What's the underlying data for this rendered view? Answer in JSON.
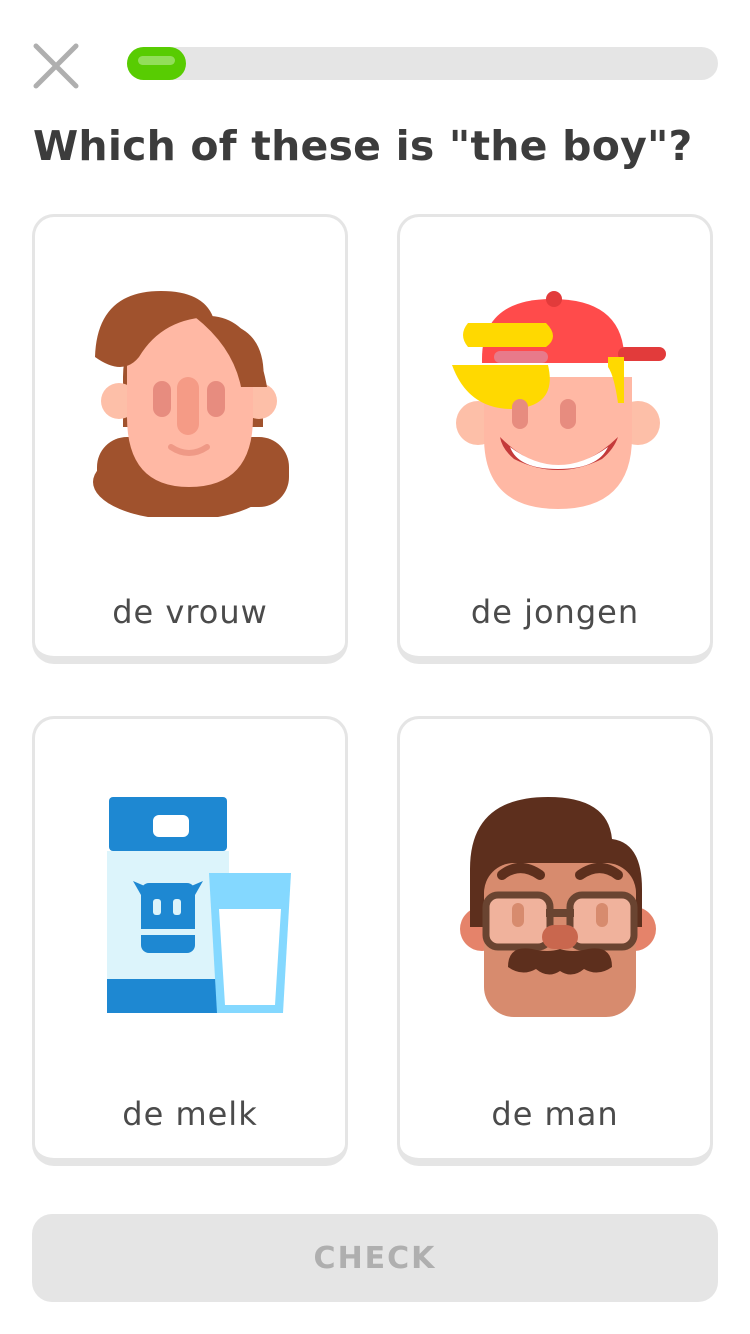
{
  "progress": {
    "value": 0.1
  },
  "question": {
    "text": "Which of these is \"the boy\"?"
  },
  "choices": [
    {
      "label": "de vrouw",
      "icon": "woman-icon"
    },
    {
      "label": "de jongen",
      "icon": "boy-icon"
    },
    {
      "label": "de melk",
      "icon": "milk-icon"
    },
    {
      "label": "de man",
      "icon": "man-icon"
    }
  ],
  "actions": {
    "check_label": "CHECK"
  },
  "colors": {
    "accent": "#58cc02",
    "card_border": "#e5e5e5",
    "text_dark": "#3c3c3c",
    "check_disabled_bg": "#e5e5e5",
    "check_disabled_text": "#afafaf"
  }
}
